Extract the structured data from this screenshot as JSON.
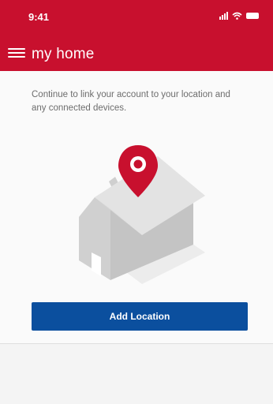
{
  "status_bar": {
    "time": "9:41"
  },
  "app_bar": {
    "title": "my home"
  },
  "main": {
    "intro_text": "Continue to link your account to your location and any connected devices.",
    "add_location_label": "Add Location"
  },
  "colors": {
    "brand_red": "#c8102e",
    "button_blue": "#0b4f9e",
    "pin_red": "#c8102e"
  },
  "icons": [
    "menu-icon",
    "signal-icon",
    "wifi-icon",
    "battery-icon",
    "location-pin-icon"
  ]
}
